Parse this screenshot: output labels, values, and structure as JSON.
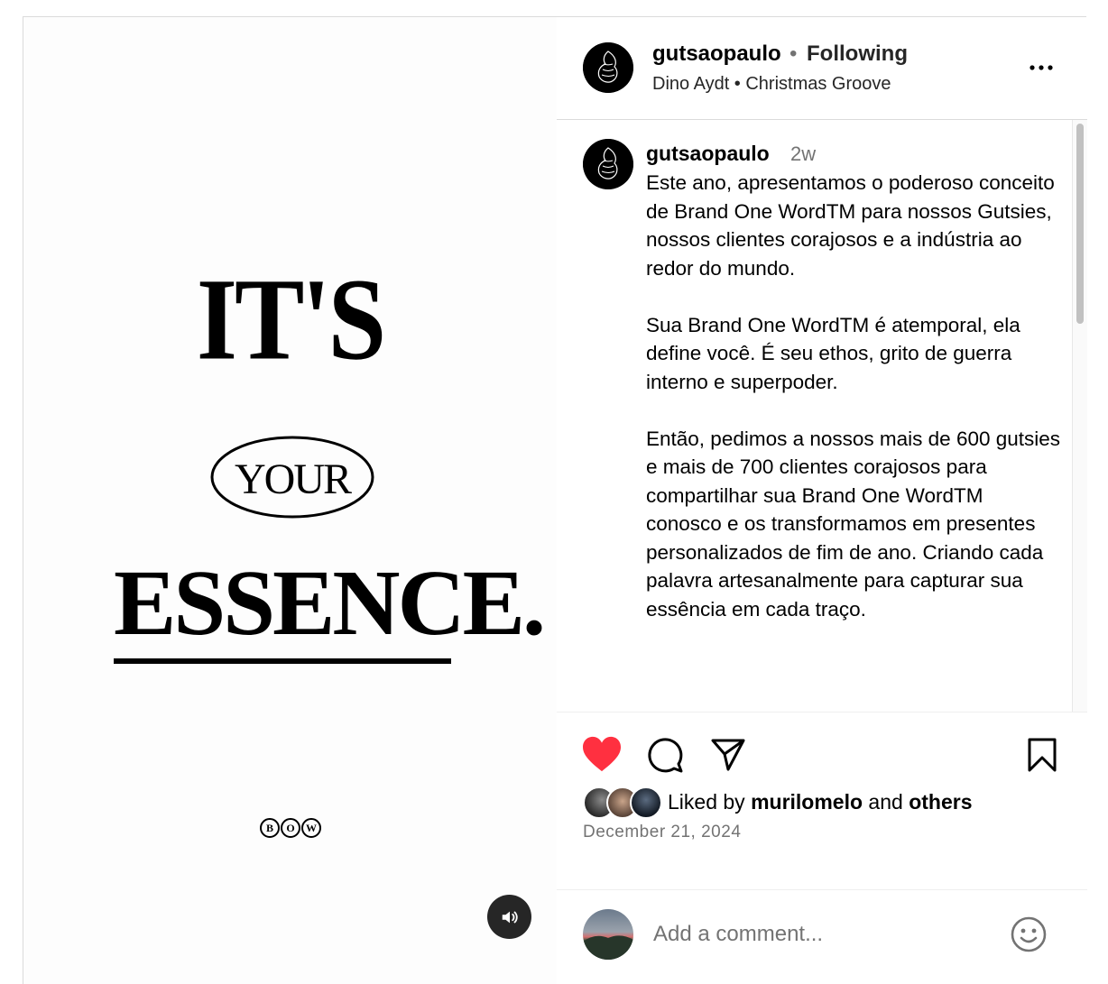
{
  "post": {
    "poster": {
      "line1": "IT'S",
      "line2": "YOUR",
      "line3": "ESSENCE.",
      "logo": [
        "B",
        "O",
        "W"
      ]
    },
    "header": {
      "username": "gutsaopaulo",
      "separator": "•",
      "follow_state": "Following",
      "audio": "Dino Aydt • Christmas Groove"
    },
    "caption": {
      "username": "gutsaopaulo",
      "time": "2w",
      "text": "Este ano, apresentamos o poderoso conceito de Brand One WordTM para nossos Gutsies, nossos clientes corajosos e a indústria ao redor do mundo.\n\nSua Brand One WordTM é atemporal, ela define você. É seu ethos, grito de guerra interno e superpoder.\n\nEntão, pedimos a nossos mais de 600 gutsies e mais de 700 clientes corajosos para compartilhar sua Brand One WordTM conosco e os transformamos em presentes personalizados de fim de ano. Criando cada palavra artesanalmente para capturar sua essência em cada traço."
    },
    "likes": {
      "prefix": "Liked by",
      "user": "murilomelo",
      "joiner": "and",
      "others": "others"
    },
    "date": "December 21, 2024",
    "comment_box": {
      "placeholder": "Add a comment..."
    },
    "icons": {
      "like": "heart-filled-icon",
      "comment": "comment-bubble-icon",
      "share": "paper-plane-icon",
      "save": "bookmark-icon",
      "more": "more-horizontal-icon",
      "sound": "speaker-icon",
      "emoji": "smiley-icon"
    },
    "colors": {
      "like": "#ff3040",
      "secondary_text": "#737373",
      "border": "#dbdbdb"
    }
  }
}
